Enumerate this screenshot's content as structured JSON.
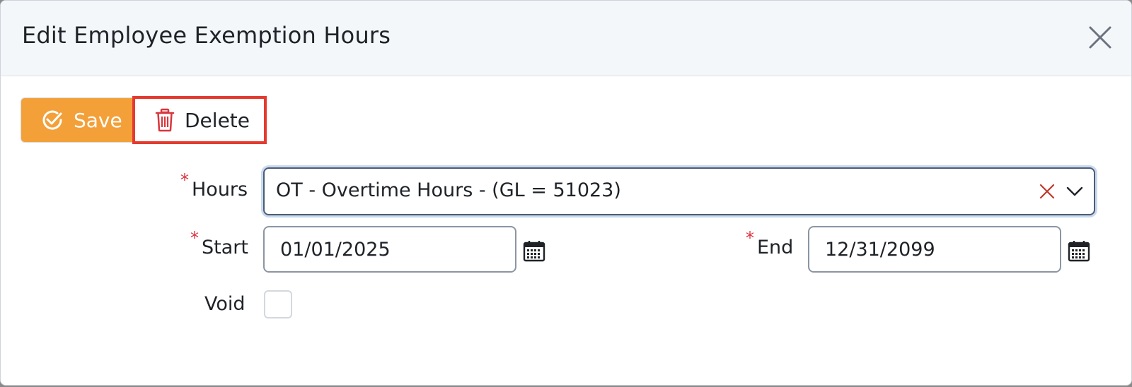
{
  "dialog": {
    "title": "Edit Employee Exemption Hours",
    "close_icon": "close-icon"
  },
  "toolbar": {
    "save_label": "Save",
    "save_icon": "check-circle-icon",
    "delete_label": "Delete",
    "delete_icon": "trash-icon"
  },
  "form": {
    "hours": {
      "label": "Hours",
      "required_mark": "*",
      "value": "OT - Overtime Hours - (GL = 51023)"
    },
    "start": {
      "label": "Start",
      "required_mark": "*",
      "value": "01/01/2025"
    },
    "end": {
      "label": "End",
      "required_mark": "*",
      "value": "12/31/2099"
    },
    "void": {
      "label": "Void",
      "checked": false
    }
  },
  "colors": {
    "save_bg": "#f3a039",
    "delete_highlight": "#e53a2f",
    "required": "#d9363e",
    "trash_icon": "#d9363e"
  }
}
